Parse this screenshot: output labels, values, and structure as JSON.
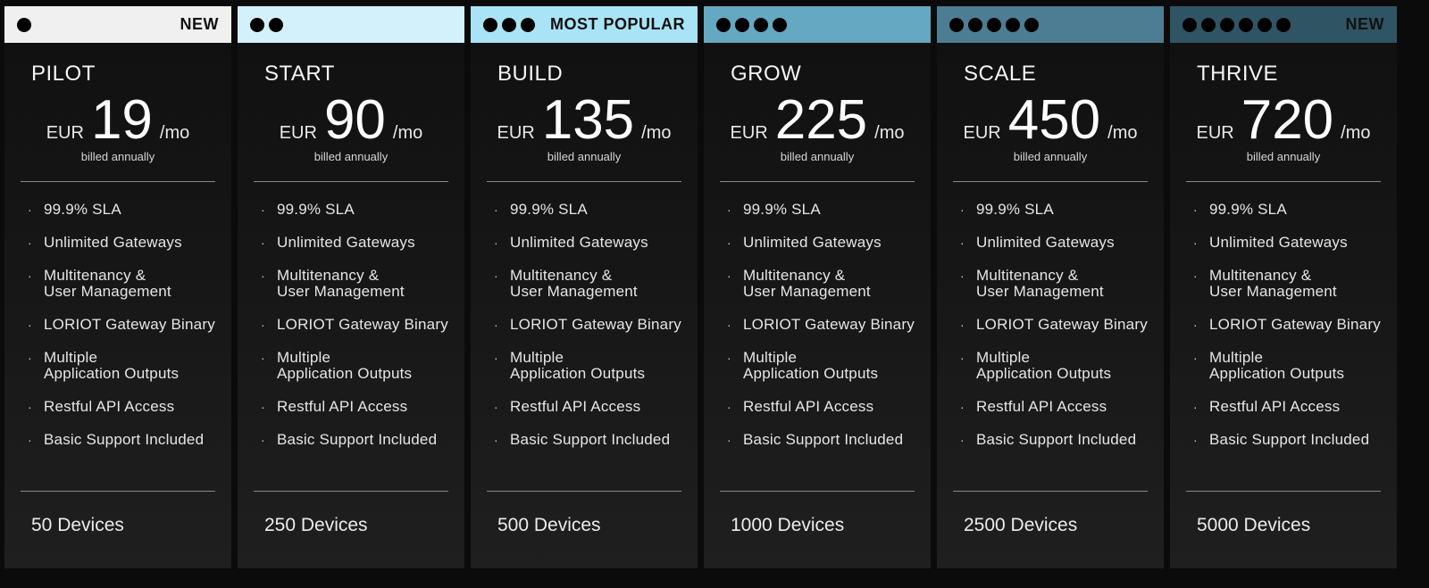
{
  "colors": {
    "page_background": "#0b0b0b",
    "card_background_top": "#101010",
    "card_background_bottom": "#1f1f1f",
    "dot_color": "#000000"
  },
  "plans": [
    {
      "dots": 1,
      "badge": "NEW",
      "header_color": "#f0f0f0",
      "name": "PILOT",
      "currency": "EUR",
      "price": "19",
      "period": "/mo",
      "billing": "billed annually",
      "features": [
        "99.9% SLA",
        "Unlimited Gateways",
        "Multitenancy &\nUser Management",
        "LORIOT Gateway Binary",
        "Multiple\nApplication Outputs",
        "Restful API Access",
        "Basic Support Included"
      ],
      "devices": "50 Devices"
    },
    {
      "dots": 2,
      "badge": "",
      "header_color": "#d3f1fa",
      "name": "START",
      "currency": "EUR",
      "price": "90",
      "period": "/mo",
      "billing": "billed annually",
      "features": [
        "99.9% SLA",
        "Unlimited Gateways",
        "Multitenancy &\nUser Management",
        "LORIOT Gateway Binary",
        "Multiple\nApplication Outputs",
        "Restful API Access",
        "Basic Support Included"
      ],
      "devices": "250 Devices"
    },
    {
      "dots": 3,
      "badge": "MOST POPULAR",
      "header_color": "#a8e4f5",
      "name": "BUILD",
      "currency": "EUR",
      "price": "135",
      "period": "/mo",
      "billing": "billed annually",
      "features": [
        "99.9% SLA",
        "Unlimited Gateways",
        "Multitenancy &\nUser Management",
        "LORIOT Gateway Binary",
        "Multiple\nApplication Outputs",
        "Restful API Access",
        "Basic Support Included"
      ],
      "devices": "500 Devices"
    },
    {
      "dots": 4,
      "badge": "",
      "header_color": "#64a8c2",
      "name": "GROW",
      "currency": "EUR",
      "price": "225",
      "period": "/mo",
      "billing": "billed annually",
      "features": [
        "99.9% SLA",
        "Unlimited Gateways",
        "Multitenancy &\nUser Management",
        "LORIOT Gateway Binary",
        "Multiple\nApplication Outputs",
        "Restful API Access",
        "Basic Support Included"
      ],
      "devices": "1000 Devices"
    },
    {
      "dots": 5,
      "badge": "",
      "header_color": "#4d7d93",
      "name": "SCALE",
      "currency": "EUR",
      "price": "450",
      "period": "/mo",
      "billing": "billed annually",
      "features": [
        "99.9% SLA",
        "Unlimited Gateways",
        "Multitenancy &\nUser Management",
        "LORIOT Gateway Binary",
        "Multiple\nApplication Outputs",
        "Restful API Access",
        "Basic Support Included"
      ],
      "devices": "2500 Devices"
    },
    {
      "dots": 6,
      "badge": "NEW",
      "header_color": "#2f5565",
      "name": "THRIVE",
      "currency": "EUR",
      "price": "720",
      "period": "/mo",
      "billing": "billed annually",
      "features": [
        "99.9% SLA",
        "Unlimited Gateways",
        "Multitenancy &\nUser Management",
        "LORIOT Gateway Binary",
        "Multiple\nApplication Outputs",
        "Restful API Access",
        "Basic Support Included"
      ],
      "devices": "5000 Devices"
    }
  ]
}
